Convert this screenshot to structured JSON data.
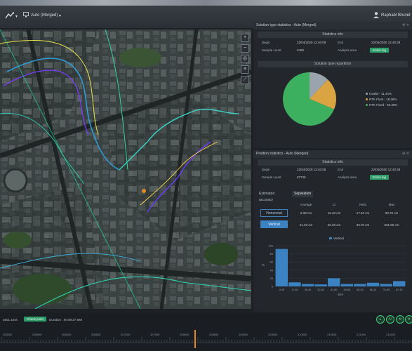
{
  "topbar": {
    "source_selector": "Auto (Merged)",
    "user_name": "Raphaël Brunet"
  },
  "map": {
    "tools": [
      "zoom-in",
      "zoom-out",
      "center",
      "layers",
      "measure"
    ]
  },
  "solution_panel": {
    "title": "Solution type statistics - Auto (Merged)",
    "stats_header": "Statistics info",
    "begin_label": "Begin",
    "begin_value": "22/04/2020 12:40:08",
    "end_label": "End",
    "end_value": "22/04/2020 12:40:36",
    "sample_label": "Sample count",
    "sample_value": "2490",
    "area_label": "Analysis area",
    "area_value": "Entire log",
    "chart_header": "Solution type repartition"
  },
  "position_panel": {
    "title": "Position statistics - Auto (Merged)",
    "stats_header": "Statistics info",
    "begin_label": "Begin",
    "begin_value": "22/04/2020 12:40:08",
    "end_label": "End",
    "end_value": "22/04/2020 12:40:36",
    "sample_label": "Sample count",
    "sample_value": "57740",
    "area_label": "Analysis area",
    "area_value": "Entire log",
    "tabs": [
      "Estimated accuracy",
      "Separation"
    ],
    "table": {
      "headers": [
        "Average",
        "CI",
        "RMS",
        "Max"
      ],
      "rows": [
        {
          "label": "Horizontal",
          "values": [
            "8.33 cm",
            "13.40 cm",
            "17.40 cm",
            "63.70 cm"
          ]
        },
        {
          "label": "Vertical",
          "values": [
            "21.20 cm",
            "26.20 cm",
            "33.70 cm",
            "621.90 cm"
          ]
        }
      ]
    }
  },
  "bottom": {
    "position": "3601.10ss",
    "status_badge": "Check point",
    "duration": "Duration : 00:08:27.888",
    "timeline_labels": [
      "205000",
      "205500",
      "206000",
      "206500",
      "207000",
      "207500",
      "208000",
      "208500",
      "209000",
      "209500",
      "210000",
      "210500",
      "211000",
      "211500"
    ]
  },
  "colors": {
    "green": "#2e9f6a",
    "blue": "#3a82c2",
    "accent_orange": "#e08a2c"
  },
  "chart_data": [
    {
      "type": "pie",
      "categories": [
        "Invalid",
        "RTK Float",
        "RTK Fixed"
      ],
      "values": [
        11.44,
        18.36,
        65.38
      ],
      "legend_labels": [
        "Invalid - 11.44%",
        "RTK Float - 18.36%",
        "RTK Fixed - 65.38%"
      ],
      "colors": [
        "#9aa4ad",
        "#d9a441",
        "#3db060"
      ],
      "legend": "right"
    },
    {
      "type": "bar",
      "series": [
        {
          "name": "Vertical",
          "values": [
            92,
            10,
            6,
            5,
            20,
            6,
            6,
            9,
            6,
            13
          ]
        }
      ],
      "categories": [
        "0.40",
        "17.80",
        "35.40",
        "52.80",
        "41.80",
        "45.80",
        "55.30",
        "66.10",
        "75.80",
        "87.40"
      ],
      "xlabel": "size",
      "ylabel": "%",
      "ylim": [
        0,
        100
      ],
      "yticks": [
        0,
        20,
        40,
        60,
        80,
        100
      ],
      "color": "#3a82c2",
      "legend": "top"
    }
  ]
}
